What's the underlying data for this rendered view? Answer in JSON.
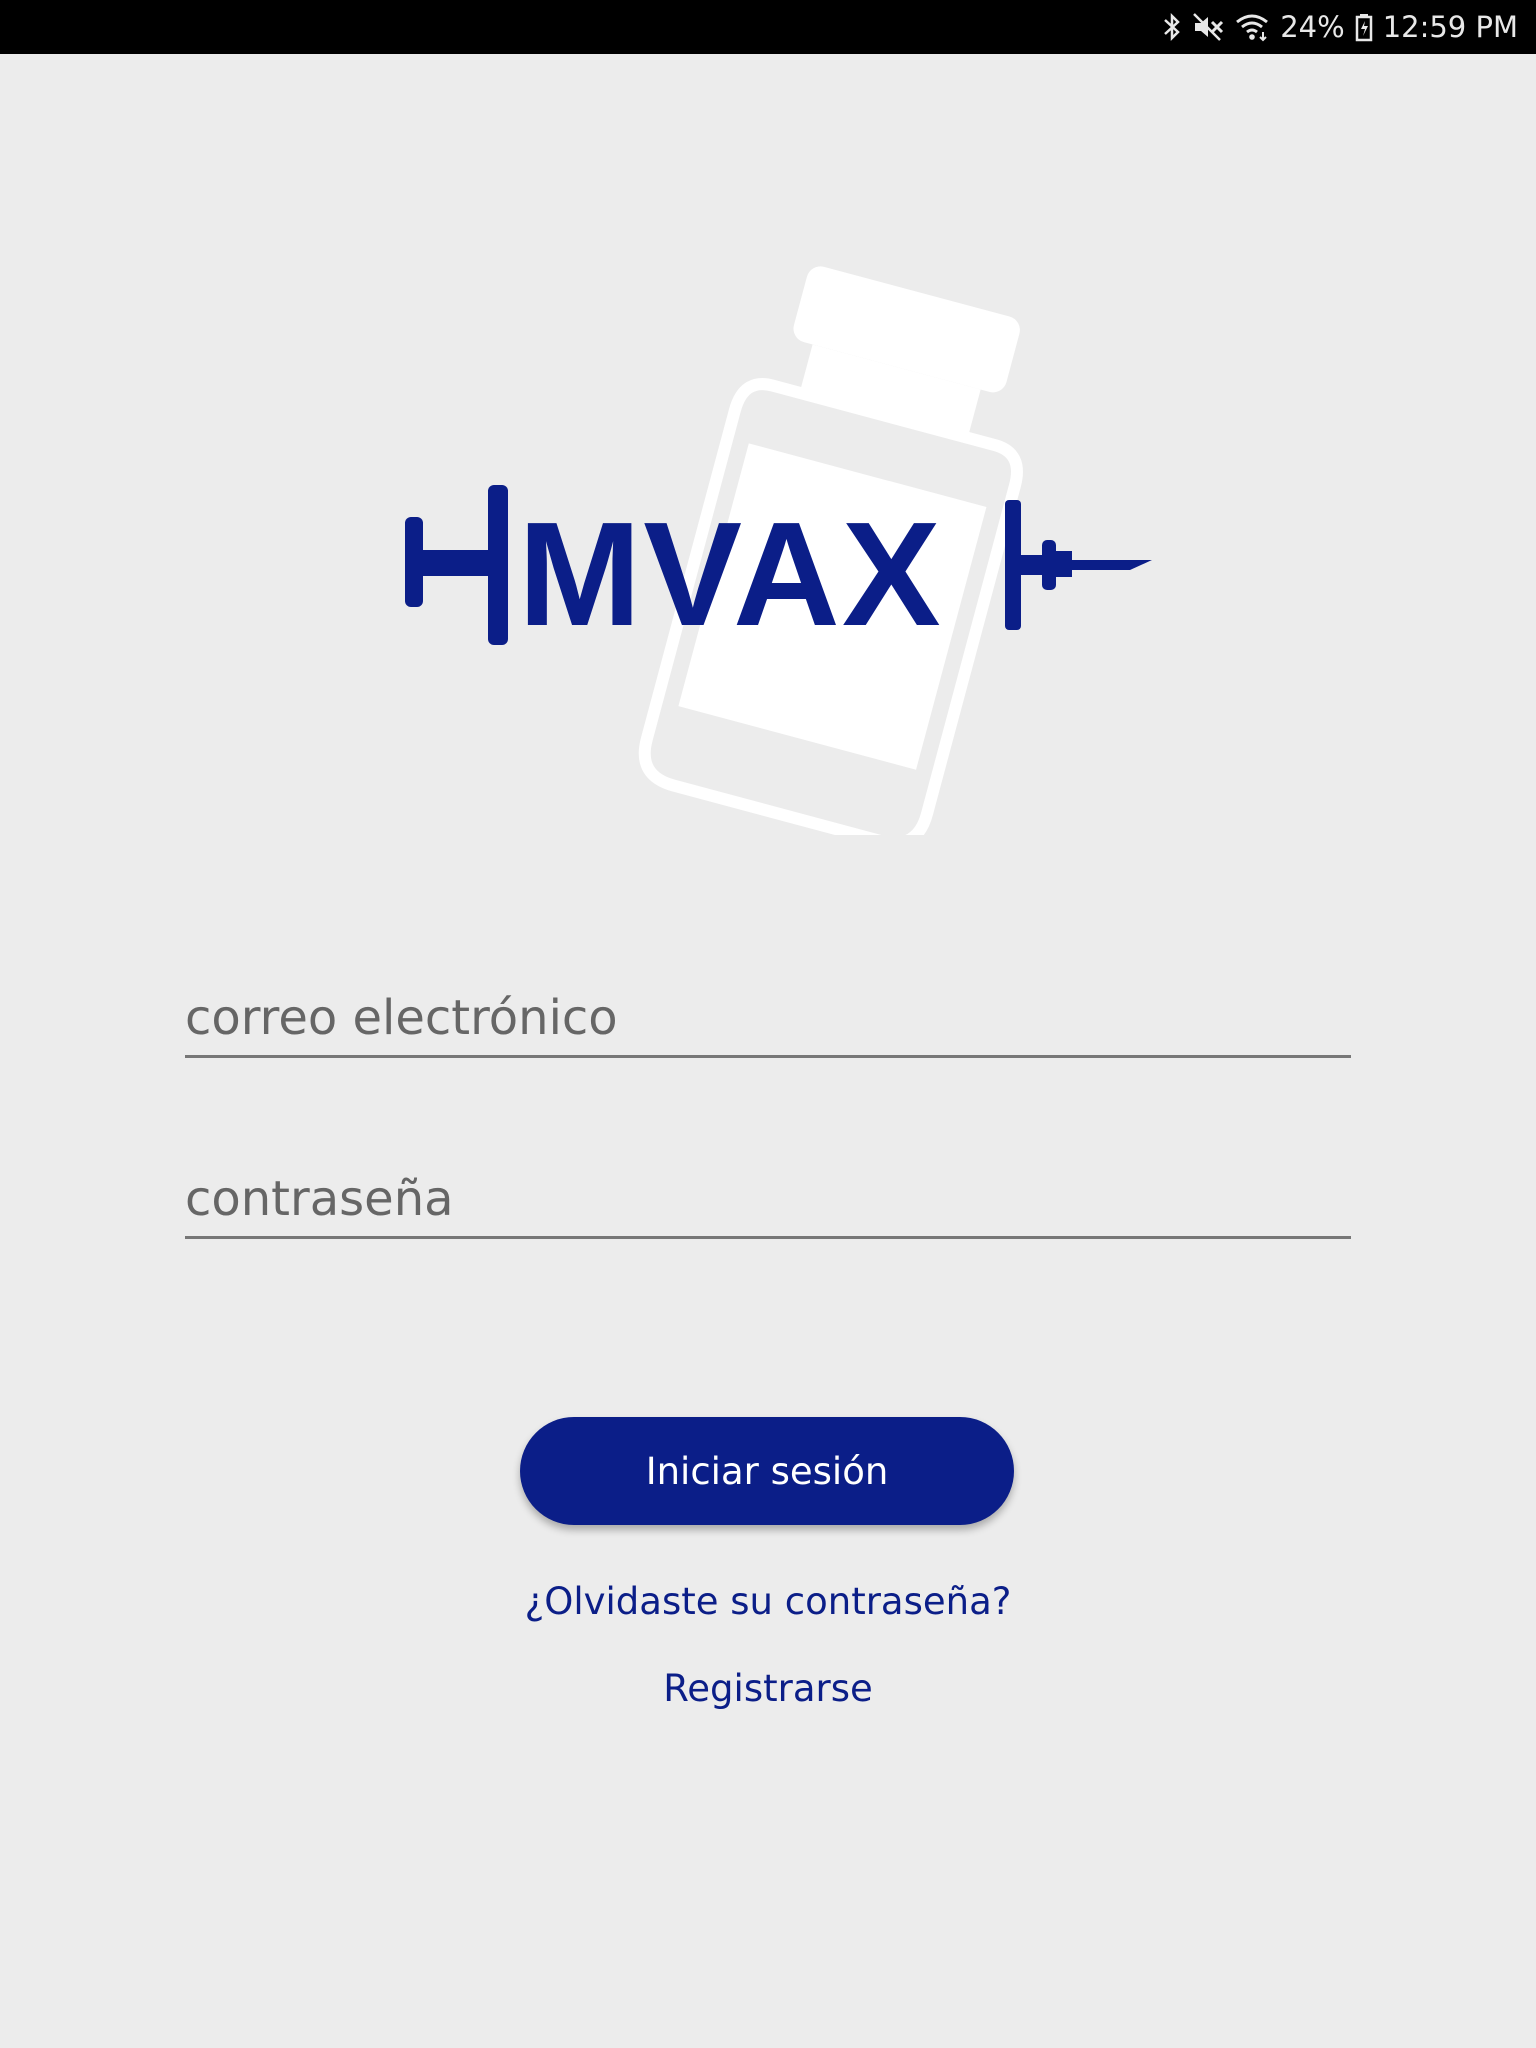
{
  "status_bar": {
    "battery": "24%",
    "time": "12:59 PM",
    "icons": [
      "bluetooth-icon",
      "mute-icon",
      "wifi-icon",
      "battery-icon"
    ]
  },
  "logo": {
    "brand_text": "MVAX",
    "colors": {
      "brand": "#0b1e88",
      "vial": "#ffffff"
    }
  },
  "login_form": {
    "email_placeholder": "correo electrónico",
    "email_value": "",
    "password_placeholder": "contraseña",
    "password_value": "",
    "submit_label": "Iniciar sesión",
    "forgot_password_label": "¿Olvidaste su contraseña?",
    "register_label": "Registrarse"
  },
  "colors": {
    "background": "#ececec",
    "accent": "#0b1e88",
    "status_bar": "#000000"
  }
}
